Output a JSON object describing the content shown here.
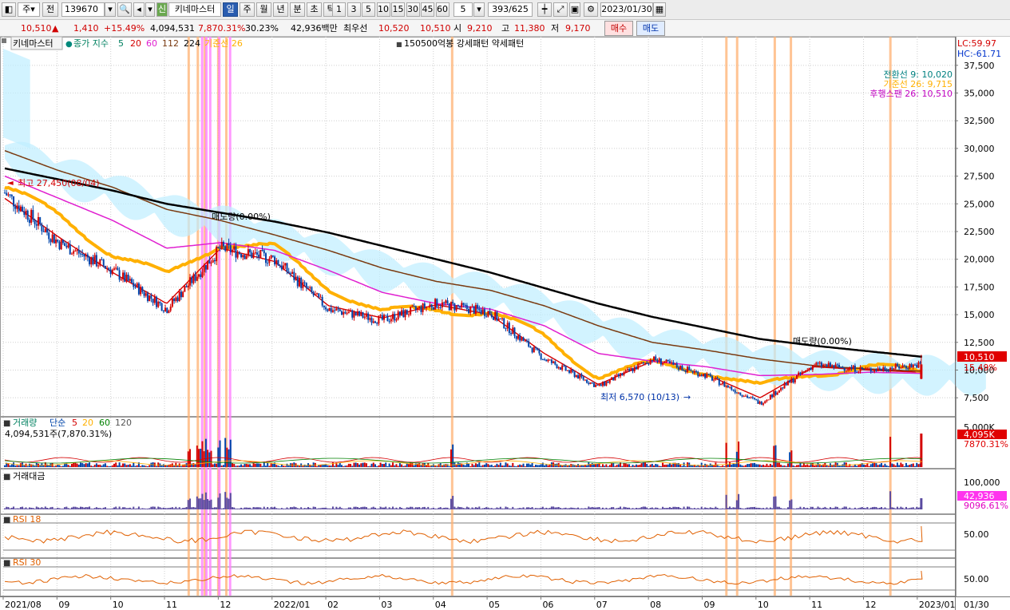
{
  "toolbar": {
    "type_select": "주",
    "prev_btn": "전",
    "code": "139670",
    "theme_badge": "신",
    "stock_name": "키네마스터",
    "periods": [
      "일",
      "주",
      "월",
      "년",
      "분",
      "초",
      "틱"
    ],
    "minutes": [
      "1",
      "3",
      "5",
      "10",
      "15",
      "30",
      "45",
      "60"
    ],
    "count_select": "5",
    "range": "393/625",
    "date": "2023/01/30"
  },
  "quote": {
    "price": "10,510",
    "direction": "▲",
    "change": "1,410",
    "change_pct": "+15.49%",
    "volume": "4,094,531",
    "volume_ratio": "7,870.31%",
    "turnover": "30.23%",
    "amount": "42,936백만",
    "best_label": "최우선",
    "best_ask": "10,520",
    "best_bid": "10,510",
    "open_label": "시",
    "open": "9,210",
    "high_label": "고",
    "high": "11,380",
    "low_label": "저",
    "low": "9,170",
    "buy_label": "매수",
    "sell_label": "매도"
  },
  "price_panel": {
    "legend_name": "키네마스터",
    "legend_ma": "종가 지수",
    "ma_periods": [
      "5",
      "20",
      "60",
      "112",
      "224"
    ],
    "legend_base": "기준선 26",
    "legend_extra": "150500억봉 강세패턴  약세패턴",
    "lc": "LC:59.97",
    "hc": "HC:-61.71",
    "ichimoku": [
      "전환선 9: 10,020",
      "기준선 26: 9,715",
      "후행스팬 26: 10,510"
    ],
    "ann_high": "최고 27,450(08/04)",
    "ann_low": "최저 6,570 (10/13)",
    "ann_target1": "매도량(0.00%)",
    "ann_target2": "매도량(0.00%)",
    "price_tag": "10,510",
    "pct_tag": "15.49%",
    "y_ticks": [
      "37,500",
      "35,000",
      "32,500",
      "30,000",
      "27,500",
      "25,000",
      "22,500",
      "20,000",
      "17,500",
      "15,000",
      "12,500",
      "10,000",
      "7,500"
    ]
  },
  "volume_panel": {
    "title": "거래량",
    "ma_label": "단순",
    "ma_periods": [
      "5",
      "20",
      "60",
      "120"
    ],
    "value": "4,094,531주(7,870.31%)",
    "axis": "5,000K",
    "tag": "4,095K",
    "tag2": "7870.31%"
  },
  "amount_panel": {
    "title": "거래대금",
    "axis": "100,000",
    "tag": "42,936",
    "tag2": "9096.61%"
  },
  "rsi18": {
    "title": "RSI 18",
    "axis": "50.00"
  },
  "rsi30": {
    "title": "RSI 30",
    "axis": "50.00"
  },
  "x_axis": [
    "2021/08",
    "09",
    "10",
    "11",
    "12",
    "2022/01",
    "02",
    "03",
    "04",
    "05",
    "06",
    "07",
    "08",
    "09",
    "10",
    "11",
    "12",
    "2023/01"
  ],
  "x_axis_right": "01/30",
  "colors": {
    "up": "#d40000",
    "down": "#0044aa",
    "ma5": "#d40000",
    "ma20": "#ffb000",
    "ma60": "#e020d0",
    "ma112": "#7a3a10",
    "ma224": "#000000",
    "cloud": "#bfeeff",
    "orange_line": "#ffb070",
    "pink_line": "#ff80ff"
  },
  "chart_data": {
    "type": "candlestick",
    "title": "키네마스터",
    "ylim": [
      6000,
      39000
    ],
    "months": [
      "2021/08",
      "09",
      "10",
      "11",
      "12",
      "2022/01",
      "02",
      "03",
      "04",
      "05",
      "06",
      "07",
      "08",
      "09",
      "10",
      "11",
      "12",
      "2023/01"
    ],
    "close_path_monthly": [
      26000,
      21500,
      19000,
      15500,
      21000,
      20000,
      15500,
      14500,
      16000,
      15200,
      11000,
      8500,
      11000,
      9500,
      7000,
      10500,
      10000,
      10510
    ],
    "series": [
      {
        "name": "5",
        "trend": [
          25500,
          22000,
          18800,
          16000,
          21000,
          19800,
          15800,
          14700,
          15900,
          15000,
          11500,
          8700,
          10800,
          9600,
          7500,
          10300,
          10000,
          9800
        ]
      },
      {
        "name": "20",
        "trend": [
          26500,
          24000,
          20500,
          18500,
          21500,
          21000,
          17500,
          15200,
          15500,
          15200,
          13000,
          9500,
          10500,
          10000,
          8400,
          9800,
          10200,
          9900
        ]
      },
      {
        "name": "60",
        "trend": [
          27500,
          25500,
          23500,
          21000,
          21500,
          20800,
          19000,
          17000,
          16000,
          15500,
          14000,
          11500,
          10800,
          10300,
          9500,
          9600,
          9800,
          9700
        ]
      },
      {
        "name": "112",
        "trend": [
          29800,
          28000,
          26500,
          24500,
          23500,
          22200,
          20800,
          19200,
          18000,
          17200,
          15800,
          14000,
          12500,
          11800,
          11000,
          10400,
          10100,
          9900
        ]
      },
      {
        "name": "224",
        "trend": [
          28200,
          27200,
          26200,
          25000,
          24200,
          23400,
          22400,
          21200,
          20000,
          18800,
          17400,
          16000,
          14800,
          13800,
          12800,
          12200,
          11700,
          11200
        ]
      }
    ],
    "events": {
      "orange_months_frac": [
        3.45,
        3.62,
        3.75,
        4.0,
        4.15,
        8.35,
        13.45,
        13.65,
        14.35,
        14.65,
        16.5
      ],
      "pink_months_frac": [
        3.7,
        3.78,
        3.85,
        4.02,
        4.22
      ]
    },
    "last": {
      "price": 10510,
      "high": 11380,
      "low": 9170,
      "open": 9210,
      "volume": 4094531
    },
    "extremes": {
      "high": 27450,
      "low": 6570
    }
  }
}
